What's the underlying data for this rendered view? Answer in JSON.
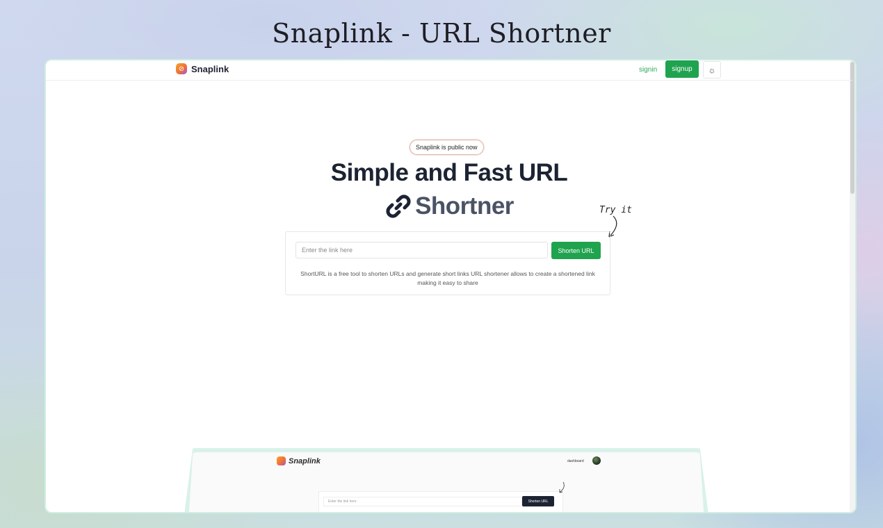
{
  "page_heading": "Snaplink - URL Shortner",
  "nav": {
    "brand": "Snaplink",
    "signin": "signin",
    "signup": "signup",
    "theme_icon": "sun-icon"
  },
  "hero": {
    "badge": "Snaplink is public now",
    "title_line1": "Simple and Fast URL",
    "title_line2": "Shortner",
    "annotation": "Try it"
  },
  "form": {
    "placeholder": "Enter the link here",
    "button": "Shorten URL",
    "description": "ShortURL is a free tool to shorten URLs and generate short links URL shortener allows to create a shortened link making it easy to share"
  },
  "preview": {
    "brand": "Snaplink",
    "dashboard": "dashboard",
    "placeholder": "Enter the link here",
    "button": "Shorten URL"
  },
  "colors": {
    "accent": "#20a34e",
    "dark": "#1c2333"
  }
}
